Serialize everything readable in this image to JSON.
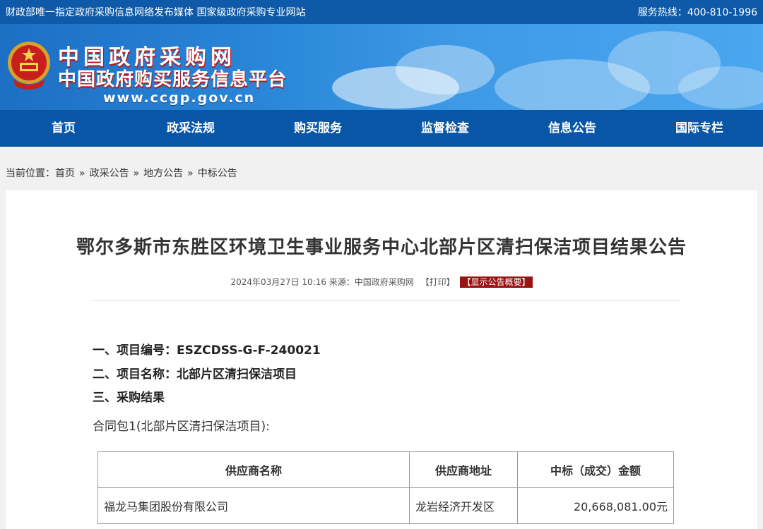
{
  "topbar": {
    "left_text": "财政部唯一指定政府采购信息网络发布媒体 国家级政府采购专业网站",
    "right_text": "服务热线：400-810-1996"
  },
  "banner": {
    "brand_line1": "中国政府采购网",
    "brand_line2": "中国政府购买服务信息平台",
    "url": "www.ccgp.gov.cn"
  },
  "nav": {
    "items": [
      "首页",
      "政采法规",
      "购买服务",
      "监督检查",
      "信息公告",
      "国际专栏"
    ]
  },
  "breadcrumb": {
    "prefix": "当前位置：",
    "items": [
      "首页",
      "政采公告",
      "地方公告",
      "中标公告"
    ],
    "separator": "»"
  },
  "article": {
    "title": "鄂尔多斯市东胜区环境卫生事业服务中心北部片区清扫保洁项目结果公告",
    "meta_datetime": "2024年03月27日 10:16",
    "meta_source": "来源：中国政府采购网",
    "meta_print": "【打印】",
    "meta_summary": "【显示公告概要】",
    "section1": "一、项目编号：ESZCDSS-G-F-240021",
    "section2": "二、项目名称：北部片区清扫保洁项目",
    "section3": "三、采购结果",
    "package_label": "合同包1(北部片区清扫保洁项目):",
    "table": {
      "headers": [
        "供应商名称",
        "供应商地址",
        "中标（成交）金额"
      ],
      "rows": [
        [
          "福龙马集团股份有限公司",
          "龙岩经济开发区",
          "20,668,081.00元"
        ]
      ]
    }
  },
  "colors": {
    "topbar_bg": "#0f5aa8",
    "nav_bg": "#0a56a6",
    "summary_badge": "#9a1212"
  }
}
